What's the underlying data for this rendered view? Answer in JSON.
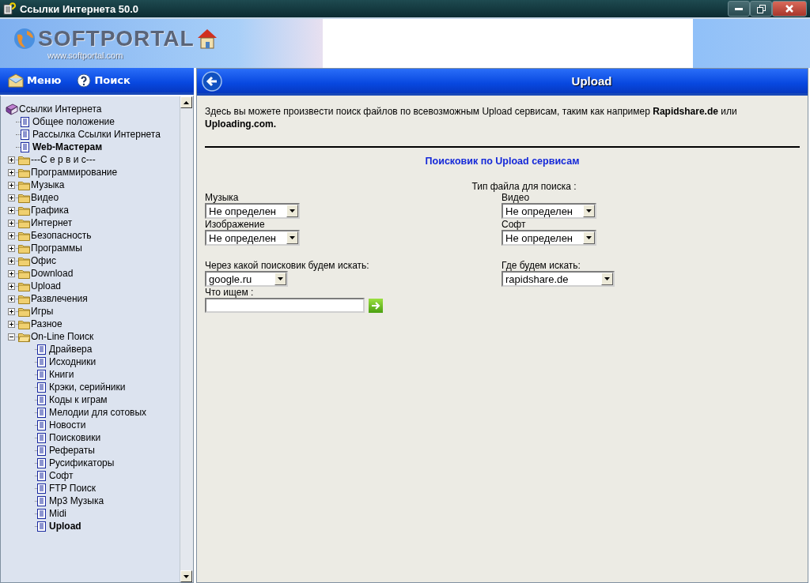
{
  "window": {
    "title": "Ссылки Интернета 50.0"
  },
  "banner": {
    "logo_text": "SOFTPORTAL",
    "url": "www.softportal.com"
  },
  "sidebar": {
    "buttons": [
      {
        "kind": "menu",
        "label": "Меню"
      },
      {
        "kind": "search",
        "label": "Поиск"
      }
    ],
    "tree": {
      "kind": "root",
      "label": "Ссылки Интернета",
      "children": [
        {
          "kind": "page",
          "label": "Общее положение",
          "bold": false
        },
        {
          "kind": "page",
          "label": "Рассылка Ссылки Интернета",
          "bold": false
        },
        {
          "kind": "page",
          "label": "Web-Мастерам",
          "bold": true
        },
        {
          "kind": "folder",
          "label": "---С е р в и с---",
          "expanded": false
        },
        {
          "kind": "folder",
          "label": "Программирование",
          "expanded": false
        },
        {
          "kind": "folder",
          "label": "Музыка",
          "expanded": false
        },
        {
          "kind": "folder",
          "label": "Видео",
          "expanded": false
        },
        {
          "kind": "folder",
          "label": "Графика",
          "expanded": false
        },
        {
          "kind": "folder",
          "label": "Интернет",
          "expanded": false
        },
        {
          "kind": "folder",
          "label": "Безопасность",
          "expanded": false
        },
        {
          "kind": "folder",
          "label": "Программы",
          "expanded": false
        },
        {
          "kind": "folder",
          "label": "Офис",
          "expanded": false
        },
        {
          "kind": "folder",
          "label": "Download",
          "expanded": false
        },
        {
          "kind": "folder",
          "label": "Upload",
          "expanded": false
        },
        {
          "kind": "folder",
          "label": "Развлечения",
          "expanded": false
        },
        {
          "kind": "folder",
          "label": "Игры",
          "expanded": false
        },
        {
          "kind": "folder",
          "label": "Разное",
          "expanded": false
        },
        {
          "kind": "folder",
          "label": "On-Line Поиск",
          "expanded": true,
          "children": [
            {
              "kind": "page",
              "label": "Драйвера",
              "bold": false
            },
            {
              "kind": "page",
              "label": "Исходники",
              "bold": false
            },
            {
              "kind": "page",
              "label": "Книги",
              "bold": false
            },
            {
              "kind": "page",
              "label": "Крэки, серийники",
              "bold": false
            },
            {
              "kind": "page",
              "label": "Коды к играм",
              "bold": false
            },
            {
              "kind": "page",
              "label": "Мелодии для сотовых",
              "bold": false
            },
            {
              "kind": "page",
              "label": "Новости",
              "bold": false
            },
            {
              "kind": "page",
              "label": "Поисковики",
              "bold": false
            },
            {
              "kind": "page",
              "label": "Рефераты",
              "bold": false
            },
            {
              "kind": "page",
              "label": "Русификаторы",
              "bold": false
            },
            {
              "kind": "page",
              "label": "Софт",
              "bold": false
            },
            {
              "kind": "page",
              "label": "FTP Поиск",
              "bold": false
            },
            {
              "kind": "page",
              "label": "Mp3 Музыка",
              "bold": false
            },
            {
              "kind": "page",
              "label": "Midi",
              "bold": false
            },
            {
              "kind": "page",
              "label": "Upload",
              "bold": true
            }
          ]
        }
      ]
    }
  },
  "page": {
    "title": "Upload",
    "intro": "Здесь вы можете произвести поиск файлов по всевозможным Upload сервисам,  таким как например **Rapidshare.de** или **Uploading.com.**",
    "section_title": "Поисковик по Upload сервисам",
    "file_type_label": "Тип файла для поиска :",
    "file_types": [
      {
        "label": "Музыка",
        "value": "Не определен"
      },
      {
        "label": "Видео",
        "value": "Не определен"
      },
      {
        "label": "Изображение",
        "value": "Не определен"
      },
      {
        "label": "Софт",
        "value": "Не определен"
      }
    ],
    "engine": {
      "label": "Через какой поисковик будем искать:",
      "value": "google.ru"
    },
    "where": {
      "label": "Где будем искать:",
      "value": "rapidshare.de"
    },
    "query": {
      "label": "Что ищем :"
    }
  }
}
